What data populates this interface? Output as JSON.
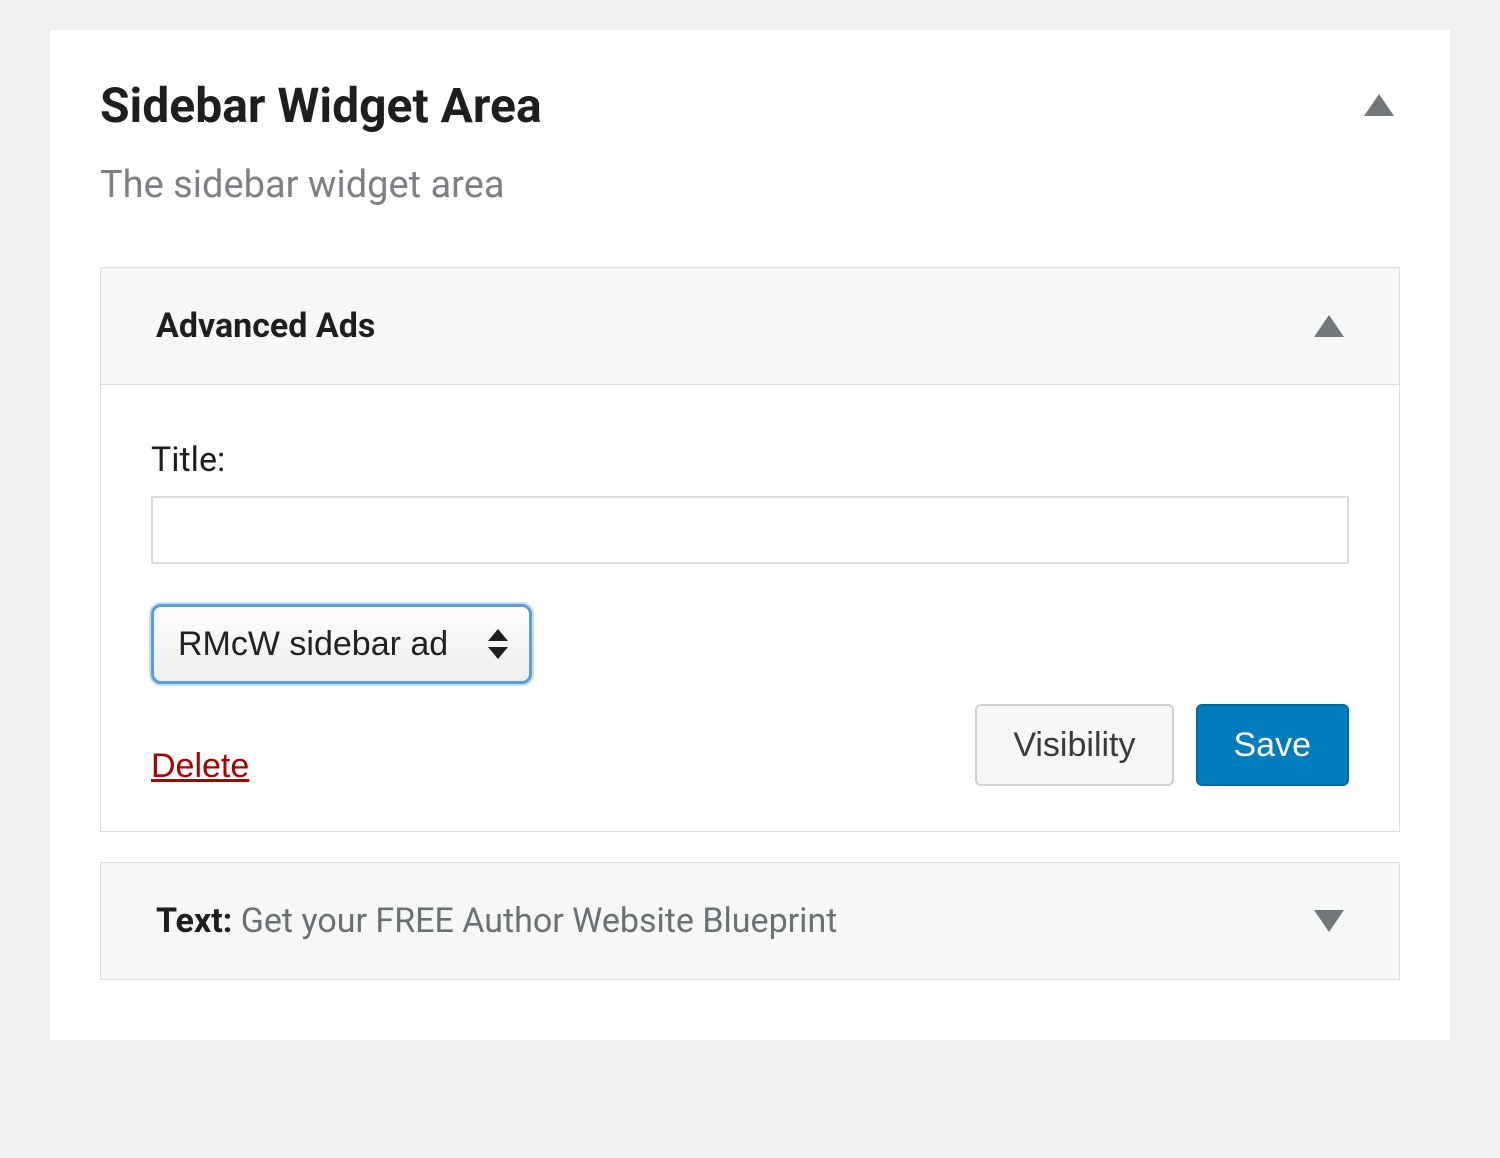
{
  "sidebarArea": {
    "title": "Sidebar Widget Area",
    "description": "The sidebar widget area"
  },
  "widgets": {
    "advancedAds": {
      "name": "Advanced Ads",
      "fields": {
        "titleLabel": "Title:",
        "titleValue": "",
        "adSelectValue": "RMcW sidebar ad"
      },
      "actions": {
        "delete": "Delete",
        "visibility": "Visibility",
        "save": "Save"
      }
    },
    "textWidget": {
      "name": "Text",
      "summary": "Get your FREE Author Website Blueprint"
    }
  }
}
